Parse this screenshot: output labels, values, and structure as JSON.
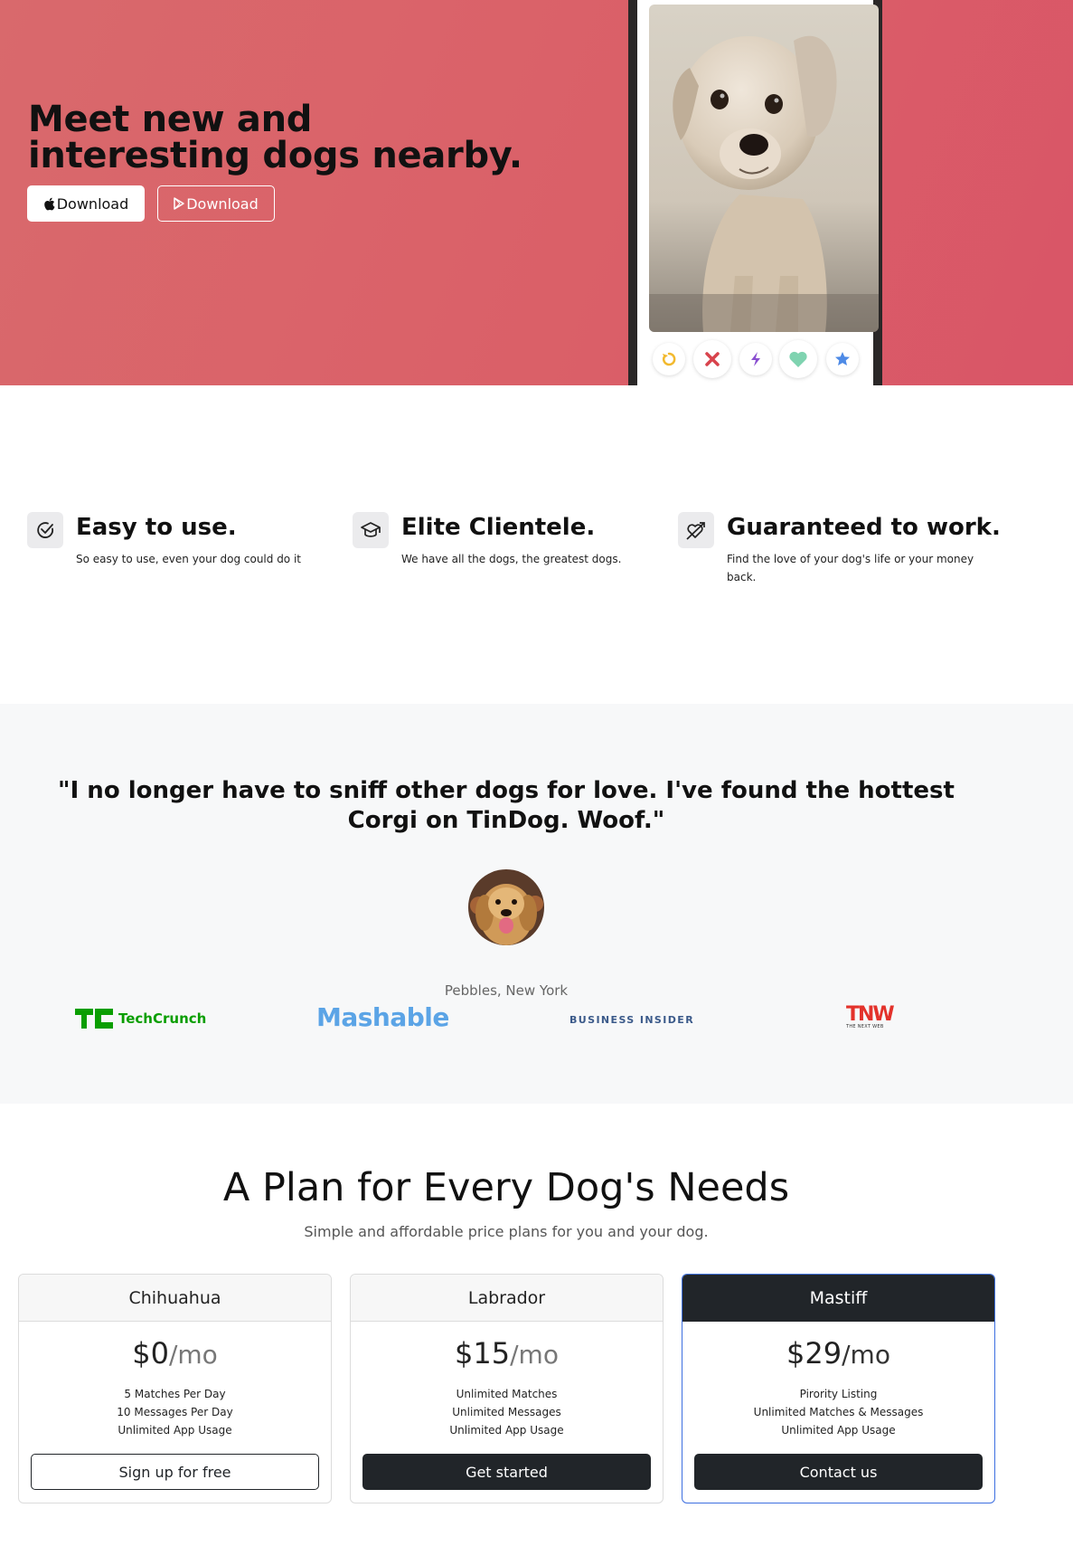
{
  "hero": {
    "title": "Meet new and interesting dogs nearby.",
    "apple_download_label": "Download",
    "play_download_label": "Download",
    "background_color": "#da6269"
  },
  "features": [
    {
      "title": "Easy to use.",
      "text": "So easy to use, even your dog could do it",
      "icon": "check-circle-icon"
    },
    {
      "title": "Elite Clientele.",
      "text": "We have all the dogs, the greatest dogs.",
      "icon": "graduation-cap-icon"
    },
    {
      "title": "Guaranteed to work.",
      "text": "Find the love of your dog's life or your money back.",
      "icon": "heart-arrow-icon"
    }
  ],
  "testimonial": {
    "quote": "\"I no longer have to sniff other dogs for love. I've found the hottest Corgi on TinDog. Woof.\"",
    "author": "Pebbles, New York"
  },
  "press_logos": {
    "techcrunch": "TechCrunch",
    "mashable": "Mashable",
    "business_insider": "BUSINESS INSIDER",
    "tnw": "TNW",
    "tnw_sub": "THE NEXT WEB"
  },
  "pricing": {
    "title": "A Plan for Every Dog's Needs",
    "subtitle": "Simple and affordable price plans for you and your dog.",
    "plans": [
      {
        "name": "Chihuahua",
        "price": "$0",
        "unit": "/mo",
        "features": [
          "5 Matches Per Day",
          "10 Messages Per Day",
          "Unlimited App Usage"
        ],
        "button": "Sign up for free"
      },
      {
        "name": "Labrador",
        "price": "$15",
        "unit": "/mo",
        "features": [
          "Unlimited Matches",
          "Unlimited Messages",
          "Unlimited App Usage"
        ],
        "button": "Get started"
      },
      {
        "name": "Mastiff",
        "price": "$29",
        "unit": "/mo",
        "features": [
          "Pirority Listing",
          "Unlimited Matches & Messages",
          "Unlimited App Usage"
        ],
        "button": "Contact us"
      }
    ]
  }
}
